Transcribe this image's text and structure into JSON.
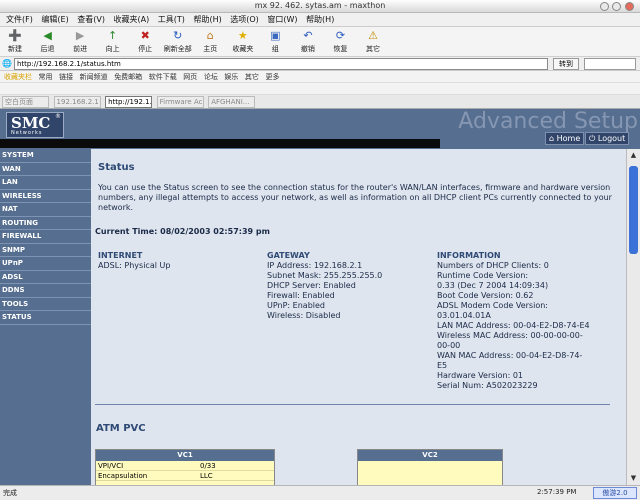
{
  "window": {
    "title": "mx 92. 462. sytas.am - maxthon"
  },
  "menubar": {
    "items": [
      "文件(F)",
      "编辑(E)",
      "查看(V)",
      "收藏夹(A)",
      "工具(T)",
      "帮助(H)",
      "选项(O)",
      "窗口(W)",
      "帮助(H)"
    ]
  },
  "toolbar": {
    "buttons": [
      {
        "icon": "➕",
        "label": "新建"
      },
      {
        "icon": "◀",
        "label": "后退"
      },
      {
        "icon": "▶",
        "label": "前进"
      },
      {
        "icon": "↑",
        "label": "向上"
      },
      {
        "icon": "✖",
        "label": "停止"
      },
      {
        "icon": "↻",
        "label": "刷新全部"
      },
      {
        "icon": "⌂",
        "label": "主页"
      },
      {
        "icon": "★",
        "label": "收藏夹"
      },
      {
        "icon": "▣",
        "label": "组"
      },
      {
        "icon": "↶",
        "label": "撤销"
      },
      {
        "icon": "⟳",
        "label": "恢复"
      },
      {
        "icon": "⚠",
        "label": "其它"
      }
    ]
  },
  "address": {
    "value": "http://192.168.2.1/status.htm",
    "go": "转到"
  },
  "bookmarks": {
    "items": [
      "收藏夹栏",
      "常用",
      "链接",
      "新闻频道",
      "免费邮箱",
      "软件下载",
      "网页",
      "论坛",
      "娱乐",
      "其它",
      "更多"
    ]
  },
  "tabs": [
    {
      "label": "空白页面",
      "active": false
    },
    {
      "label": "192.168.2.1",
      "active": false
    },
    {
      "label": "http://192.1...",
      "active": true
    },
    {
      "label": "Firmware Ac",
      "active": false
    },
    {
      "label": "AFGHANI...",
      "active": false
    }
  ],
  "banner": {
    "logo": "SMC",
    "logo_sub": "Networks",
    "reg": "®",
    "advanced": "Advanced Setup",
    "home": "Home",
    "logout": "Logout"
  },
  "nav": [
    "SYSTEM",
    "WAN",
    "LAN",
    "WIRELESS",
    "NAT",
    "ROUTING",
    "FIREWALL",
    "SNMP",
    "UPnP",
    "ADSL",
    "DDNS",
    "TOOLS",
    "STATUS"
  ],
  "content": {
    "title": "Status",
    "intro": "You can use the Status screen to see the connection status for the router's WAN/LAN interfaces, firmware and hardware version numbers, any illegal attempts to access your network, as well as information on all DHCP client PCs currently connected to your network.",
    "current_time": "Current Time: 08/02/2003 02:57:39 pm",
    "internet": {
      "title": "INTERNET",
      "lines": [
        "ADSL:    Physical Up"
      ]
    },
    "gateway": {
      "title": "GATEWAY",
      "lines": [
        "IP Address:  192.168.2.1",
        "Subnet Mask:  255.255.255.0",
        "DHCP Server:  Enabled",
        "Firewall:  Enabled",
        "UPnP:  Enabled",
        "Wireless:  Disabled"
      ]
    },
    "information": {
      "title": "INFORMATION",
      "lines": [
        "Numbers of DHCP Clients:  0",
        "Runtime Code Version:",
        "   0.33 (Dec 7 2004 14:09:34)",
        "Boot Code Version:  0.62",
        "ADSL Modem Code Version:",
        "03.01.04.01A",
        "LAN MAC Address: 00-04-E2-D8-74-E4",
        "Wireless MAC Address: 00-00-00-00-",
        "00-00",
        "WAN MAC Address: 00-04-E2-D8-74-",
        "E5",
        "Hardware Version:  01",
        "Serial Num:  A502023229"
      ]
    },
    "atm_title": "ATM PVC",
    "vc1": {
      "title": "VC1",
      "rows": [
        {
          "k": "VPI/VCI",
          "v": "0/33"
        },
        {
          "k": "Encapsulation",
          "v": "LLC"
        }
      ]
    },
    "vc2": {
      "title": "VC2"
    }
  },
  "statusbar": {
    "left": "完成",
    "time": "2:57:39 PM",
    "badge": "傲游2.0"
  }
}
